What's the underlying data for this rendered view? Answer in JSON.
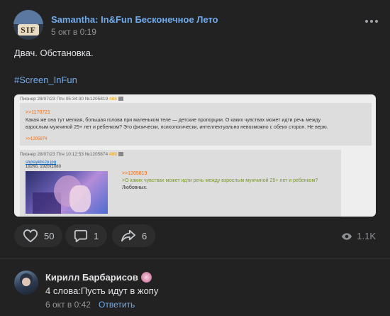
{
  "post": {
    "author": "Samantha: In&Fun Бесконечное Лето",
    "avatar_text": "SIF",
    "date": "5 окт в 0:19",
    "text": "Двач. Обстановка.",
    "hashtag": "#Screen_InFun"
  },
  "screenshot": {
    "reply1": {
      "meta": "Пионер 28/07/23 Птн 05:34:30 №1205819",
      "num": "488",
      "quote": ">>1170721",
      "body_line1": "Какая же она тут мелкая, большая голова при маленьком теле — детские пропорции. О каких чувствах может идти речь между",
      "body_line2": "взрослым мужчиной 25+ лет и ребенком? Это физически, психологически, интеллектуально невозможно с обеих сторон. Не верю.",
      "backlink": ">>1205874"
    },
    "reply2": {
      "meta": "Пионер 28/07/23 Птн 10:12:53 №1205874",
      "num": "489",
      "file_name": "sbplaykbs2p.jpg",
      "file_size": "192Кб, 1920x1080",
      "quote": ">>1205819",
      "greentext": ">О каких чувствах может идти речь между взрослым мужчиной 25+ лет и ребенком?",
      "answer": "Любовных."
    }
  },
  "actions": {
    "likes": "50",
    "comments": "1",
    "shares": "6",
    "views": "1.1K"
  },
  "comment": {
    "author": "Кирилл Барбарисов",
    "text": "4 слова:Пусть идут в жопу",
    "date": "6 окт в 0:42",
    "reply_label": "Ответить"
  },
  "colors": {
    "background": "#222222",
    "link": "#71aaeb",
    "text": "#e1e3e6",
    "muted": "#939393",
    "pill": "#2d2d2d"
  }
}
